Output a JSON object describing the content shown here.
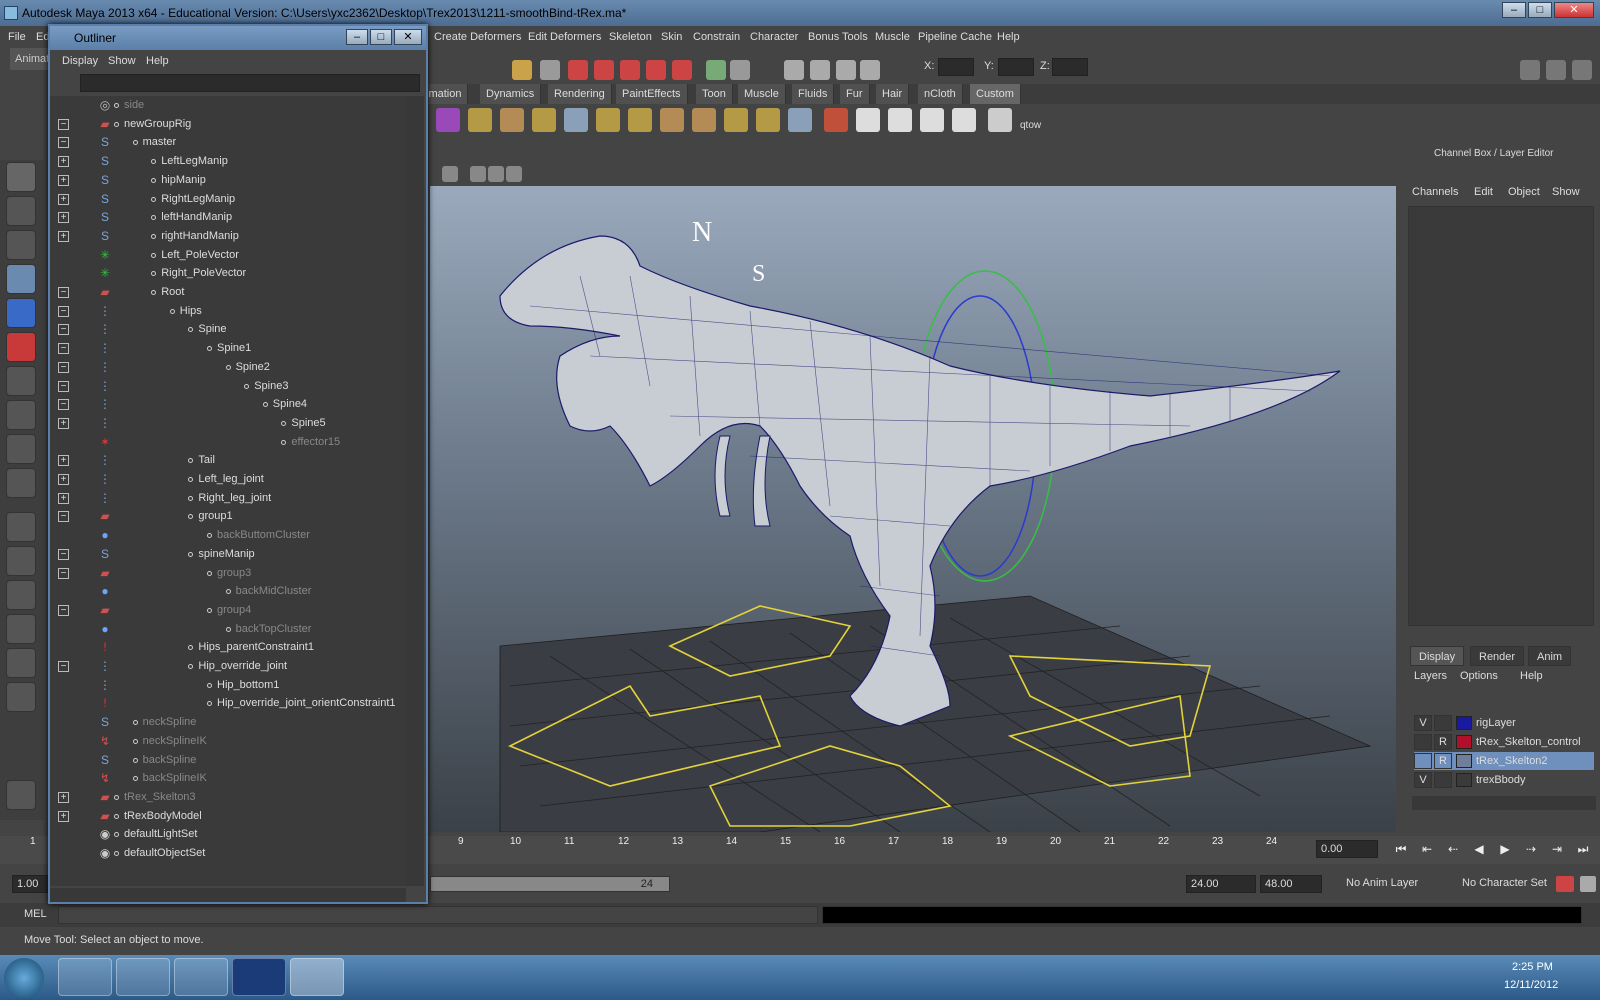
{
  "window": {
    "title": "Autodesk Maya 2013 x64 - Educational Version: C:\\Users\\yxc2362\\Desktop\\Trex2013\\1211-smoothBind-tRex.ma*"
  },
  "menus": [
    "File",
    "Ed",
    "Create Deformers",
    "Edit Deformers",
    "Skeleton",
    "Skin",
    "Constrain",
    "Character",
    "Bonus Tools",
    "Muscle",
    "Pipeline Cache",
    "Help"
  ],
  "statusline": {
    "mode": "Animat"
  },
  "xyz": {
    "x_label": "X:",
    "y_label": "Y:",
    "z_label": "Z:"
  },
  "shelf_tabs": [
    "imation",
    "Dynamics",
    "Rendering",
    "PaintEffects",
    "Toon",
    "Muscle",
    "Fluids",
    "Fur",
    "Hair",
    "nCloth",
    "Custom"
  ],
  "shelf_last_label": "qtow",
  "outliner": {
    "title": "Outliner",
    "menu": [
      "Display",
      "Show",
      "Help"
    ],
    "rows": [
      {
        "label": "side",
        "dim": true,
        "pm": "",
        "icon": "camera",
        "depth": 0
      },
      {
        "label": "newGroupRig",
        "dim": false,
        "pm": "−",
        "icon": "group",
        "depth": 0
      },
      {
        "label": "master",
        "dim": false,
        "pm": "−",
        "icon": "curve",
        "depth": 1
      },
      {
        "label": "LeftLegManip",
        "dim": false,
        "pm": "+",
        "icon": "curve",
        "depth": 2
      },
      {
        "label": "hipManip",
        "dim": false,
        "pm": "+",
        "icon": "curve",
        "depth": 2
      },
      {
        "label": "RightLegManip",
        "dim": false,
        "pm": "+",
        "icon": "curve",
        "depth": 2
      },
      {
        "label": "leftHandManip",
        "dim": false,
        "pm": "+",
        "icon": "curve",
        "depth": 2
      },
      {
        "label": "rightHandManip",
        "dim": false,
        "pm": "+",
        "icon": "curve",
        "depth": 2
      },
      {
        "label": "Left_PoleVector",
        "dim": false,
        "pm": "",
        "icon": "locator",
        "depth": 2
      },
      {
        "label": "Right_PoleVector",
        "dim": false,
        "pm": "",
        "icon": "locator",
        "depth": 2
      },
      {
        "label": "Root",
        "dim": false,
        "pm": "−",
        "icon": "group",
        "depth": 2
      },
      {
        "label": "Hips",
        "dim": false,
        "pm": "−",
        "icon": "joint",
        "depth": 3
      },
      {
        "label": "Spine",
        "dim": false,
        "pm": "−",
        "icon": "joint",
        "depth": 4
      },
      {
        "label": "Spine1",
        "dim": false,
        "pm": "−",
        "icon": "joint",
        "depth": 5
      },
      {
        "label": "Spine2",
        "dim": false,
        "pm": "−",
        "icon": "joint",
        "depth": 6
      },
      {
        "label": "Spine3",
        "dim": false,
        "pm": "−",
        "icon": "joint",
        "depth": 7
      },
      {
        "label": "Spine4",
        "dim": false,
        "pm": "−",
        "icon": "joint",
        "depth": 8
      },
      {
        "label": "Spine5",
        "dim": false,
        "pm": "+",
        "icon": "joint",
        "depth": 9
      },
      {
        "label": "effector15",
        "dim": true,
        "pm": "",
        "icon": "effector",
        "depth": 9
      },
      {
        "label": "Tail",
        "dim": false,
        "pm": "+",
        "icon": "joint",
        "depth": 4
      },
      {
        "label": "Left_leg_joint",
        "dim": false,
        "pm": "+",
        "icon": "joint",
        "depth": 4
      },
      {
        "label": "Right_leg_joint",
        "dim": false,
        "pm": "+",
        "icon": "joint",
        "depth": 4
      },
      {
        "label": "group1",
        "dim": false,
        "pm": "−",
        "icon": "group",
        "depth": 4
      },
      {
        "label": "backButtomCluster",
        "dim": true,
        "pm": "",
        "icon": "cluster",
        "depth": 5
      },
      {
        "label": "spineManip",
        "dim": false,
        "pm": "−",
        "icon": "curve",
        "depth": 4
      },
      {
        "label": "group3",
        "dim": true,
        "pm": "−",
        "icon": "group",
        "depth": 5
      },
      {
        "label": "backMidCluster",
        "dim": true,
        "pm": "",
        "icon": "cluster",
        "depth": 6
      },
      {
        "label": "group4",
        "dim": true,
        "pm": "−",
        "icon": "group",
        "depth": 5
      },
      {
        "label": "backTopCluster",
        "dim": true,
        "pm": "",
        "icon": "cluster",
        "depth": 6
      },
      {
        "label": "Hips_parentConstraint1",
        "dim": false,
        "pm": "",
        "icon": "constraint",
        "depth": 4
      },
      {
        "label": "Hip_override_joint",
        "dim": false,
        "pm": "−",
        "icon": "joint",
        "depth": 4
      },
      {
        "label": "Hip_bottom1",
        "dim": false,
        "pm": "",
        "icon": "joint",
        "depth": 5
      },
      {
        "label": "Hip_override_joint_orientConstraint1",
        "dim": false,
        "pm": "",
        "icon": "constraint",
        "depth": 5
      },
      {
        "label": "neckSpline",
        "dim": true,
        "pm": "",
        "icon": "curve",
        "depth": 1
      },
      {
        "label": "neckSplineIK",
        "dim": true,
        "pm": "",
        "icon": "ik",
        "depth": 1
      },
      {
        "label": "backSpline",
        "dim": true,
        "pm": "",
        "icon": "curve",
        "depth": 1
      },
      {
        "label": "backSplineIK",
        "dim": true,
        "pm": "",
        "icon": "ik",
        "depth": 1
      },
      {
        "label": "tRex_Skelton3",
        "dim": true,
        "pm": "+",
        "icon": "group",
        "depth": 0
      },
      {
        "label": "tRexBodyModel",
        "dim": false,
        "pm": "+",
        "icon": "group",
        "depth": 0
      },
      {
        "label": "defaultLightSet",
        "dim": false,
        "pm": "",
        "icon": "set",
        "depth": 0
      },
      {
        "label": "defaultObjectSet",
        "dim": false,
        "pm": "",
        "icon": "set",
        "depth": 0
      }
    ]
  },
  "viewport": {
    "compass_n": "N",
    "compass_s": "S"
  },
  "channelbox": {
    "title": "Channel Box / Layer Editor",
    "menu": [
      "Channels",
      "Edit",
      "Object",
      "Show"
    ]
  },
  "layers": {
    "tabs": [
      "Display",
      "Render",
      "Anim"
    ],
    "menu": [
      "Layers",
      "Options",
      "Help"
    ],
    "rows": [
      {
        "v": "V",
        "r": "",
        "color": "#1a1aa0",
        "name": "rigLayer",
        "selected": false
      },
      {
        "v": "",
        "r": "R",
        "color": "#b0102a",
        "name": "tRex_Skelton_control",
        "selected": false
      },
      {
        "v": "",
        "r": "R",
        "color": "#6f7f9a",
        "name": "tRex_Skelton2",
        "selected": true
      },
      {
        "v": "V",
        "r": "",
        "color": "",
        "name": "trexBbody",
        "selected": false
      }
    ]
  },
  "timeline": {
    "ticks": [
      "1",
      "9",
      "10",
      "11",
      "12",
      "13",
      "14",
      "15",
      "16",
      "17",
      "18",
      "19",
      "20",
      "21",
      "22",
      "23",
      "24"
    ],
    "current": "0.00"
  },
  "range": {
    "start": "1.00",
    "slider_end": "24",
    "end": "24.00",
    "max": "48.00",
    "anim_layer": "No Anim Layer",
    "char_set": "No Character Set"
  },
  "mel": {
    "label": "MEL"
  },
  "help": {
    "text": "Move Tool: Select an object to move."
  },
  "taskbar": {
    "time": "2:25 PM",
    "date": "12/11/2012"
  }
}
